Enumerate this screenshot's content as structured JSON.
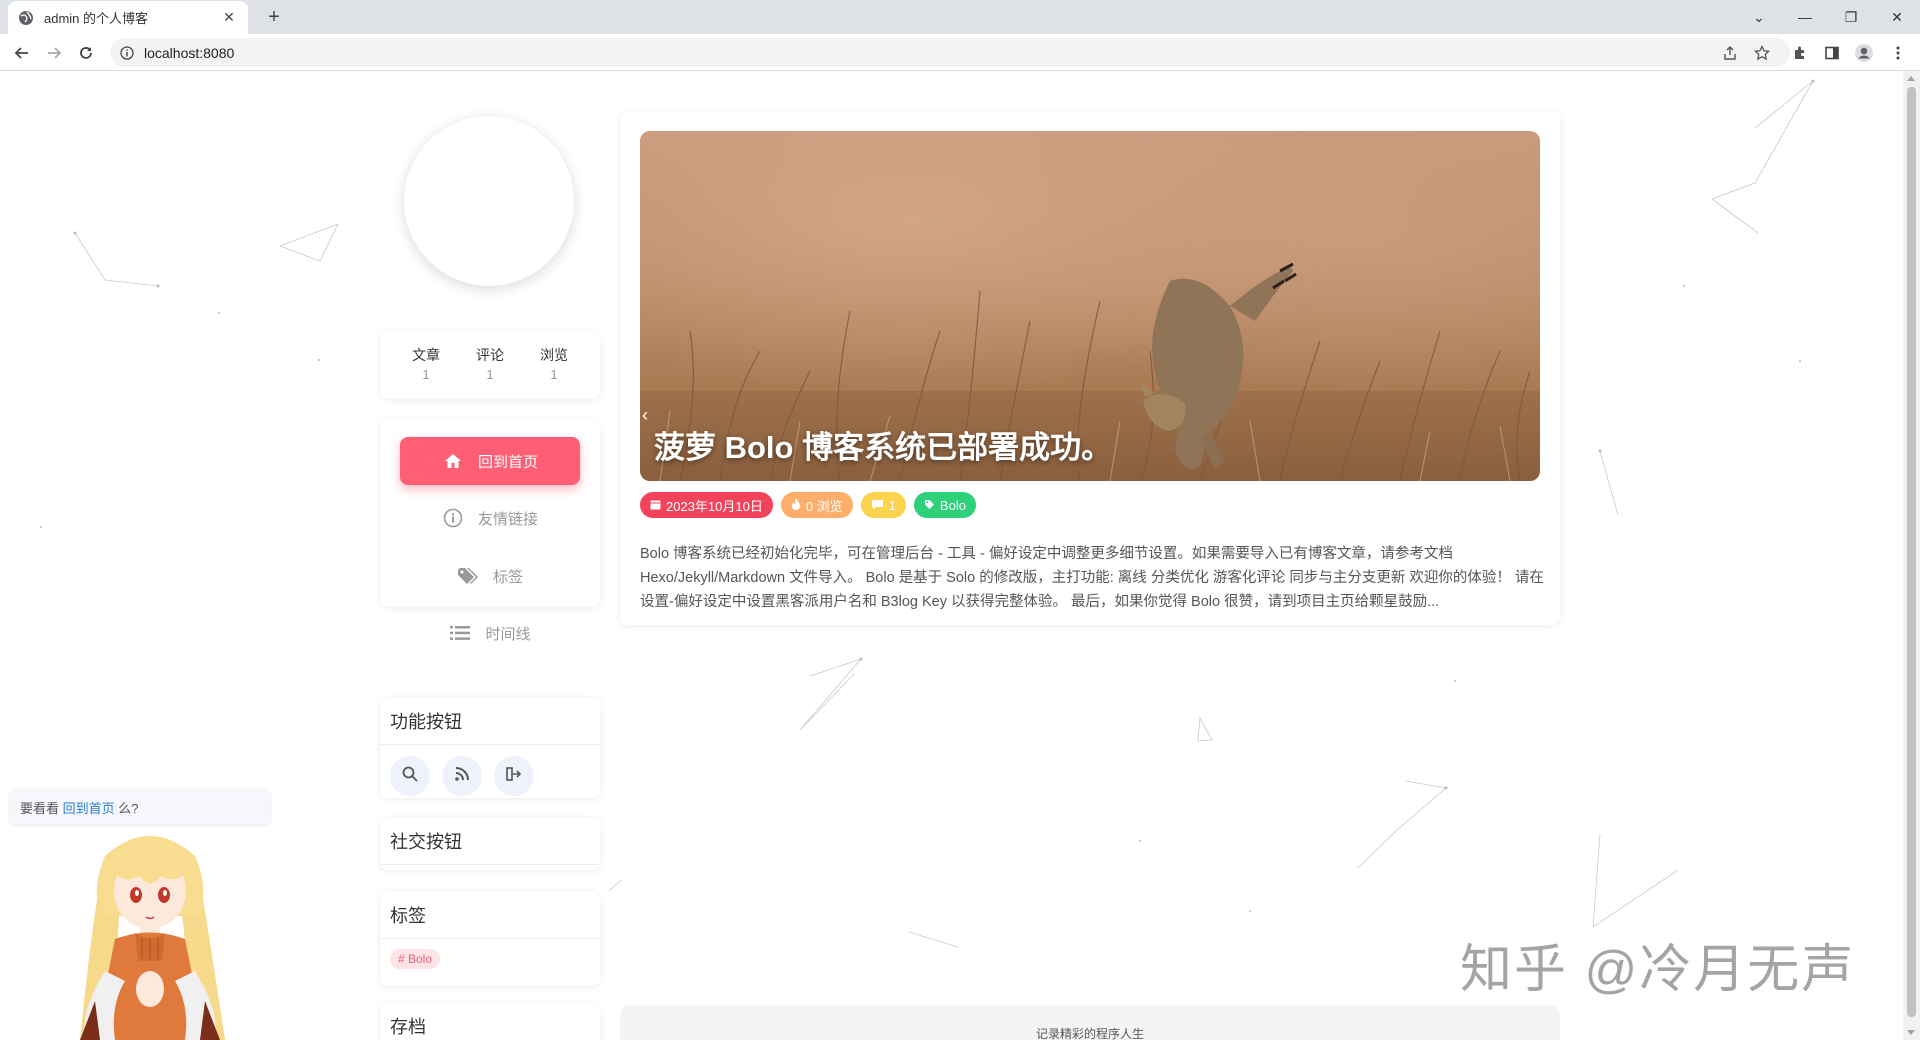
{
  "browser": {
    "tab_title": "admin 的个人博客",
    "url": "localhost:8080"
  },
  "sidebar": {
    "stats": [
      {
        "label": "文章",
        "value": "1"
      },
      {
        "label": "评论",
        "value": "1"
      },
      {
        "label": "浏览",
        "value": "1"
      }
    ],
    "nav": [
      {
        "label": "回到首页",
        "icon": "home-icon"
      },
      {
        "label": "友情链接",
        "icon": "info-icon"
      },
      {
        "label": "标签",
        "icon": "tags-icon"
      },
      {
        "label": "时间线",
        "icon": "list-icon"
      }
    ],
    "func_title": "功能按钮",
    "social_title": "社交按钮",
    "tags_title": "标签",
    "tags": [
      "# Bolo"
    ],
    "archive_title": "存档"
  },
  "post": {
    "title": "菠萝 Bolo 博客系统已部署成功。",
    "date": "2023年10月10日",
    "views": "0 浏览",
    "comments": "1",
    "tag": "Bolo",
    "excerpt": "Bolo 博客系统已经初始化完毕，可在管理后台 - 工具 - 偏好设定中调整更多细节设置。如果需要导入已有博客文章，请参考文档 Hexo/Jekyll/Markdown 文件导入。 Bolo 是基于 Solo 的修改版，主打功能: 离线 分类优化 游客化评论 同步与主分支更新 欢迎你的体验！ 请在设置-偏好设定中设置黑客派用户名和 B3log Key 以获得完整体验。 最后，如果你觉得 Bolo 很赞，请到项目主页给颗星鼓励..."
  },
  "footer": {
    "text": "记录精彩的程序人生"
  },
  "tip": {
    "prefix": "要看看",
    "link": "回到首页",
    "suffix": "么?"
  },
  "watermark": "知乎 @冷月无声",
  "colors": {
    "accent": "#fe5f75",
    "date_badge": "#f2435a",
    "views_badge": "#fcae6a",
    "comments_badge": "#fcd34d",
    "tag_badge": "#2ed07a"
  }
}
